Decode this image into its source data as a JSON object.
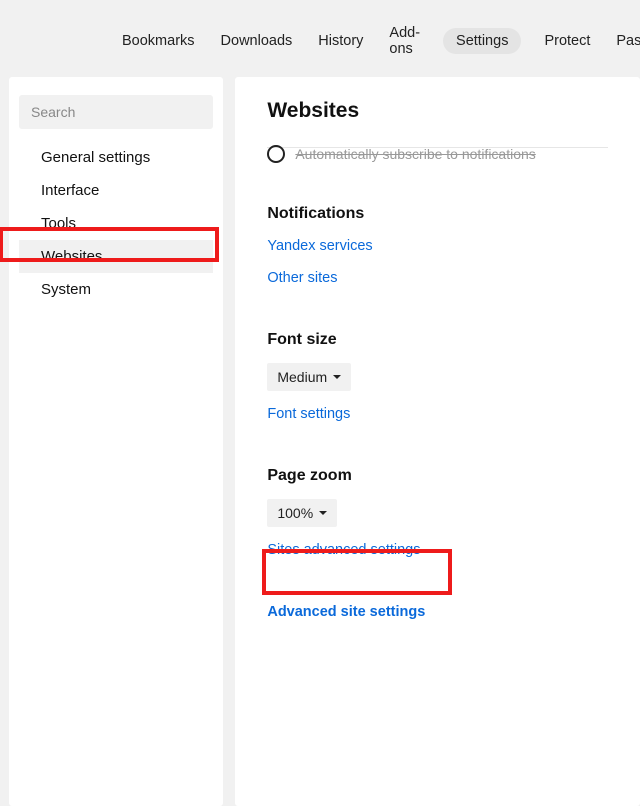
{
  "topnav": {
    "items": [
      "Bookmarks",
      "Downloads",
      "History",
      "Add-ons",
      "Settings",
      "Protect",
      "Passwords"
    ]
  },
  "sidebar": {
    "search_placeholder": "Search",
    "items": [
      "General settings",
      "Interface",
      "Tools",
      "Websites",
      "System"
    ]
  },
  "page": {
    "title": "Websites",
    "cutline": "Automatically subscribe to notifications",
    "notifications_heading": "Notifications",
    "notifications_yandex": "Yandex services",
    "notifications_other": "Other sites",
    "fontsize_heading": "Font size",
    "fontsize_value": "Medium",
    "fontsize_link": "Font settings",
    "zoom_heading": "Page zoom",
    "zoom_value": "100%",
    "zoom_link": "Sites advanced settings",
    "advanced_link": "Advanced site settings"
  }
}
